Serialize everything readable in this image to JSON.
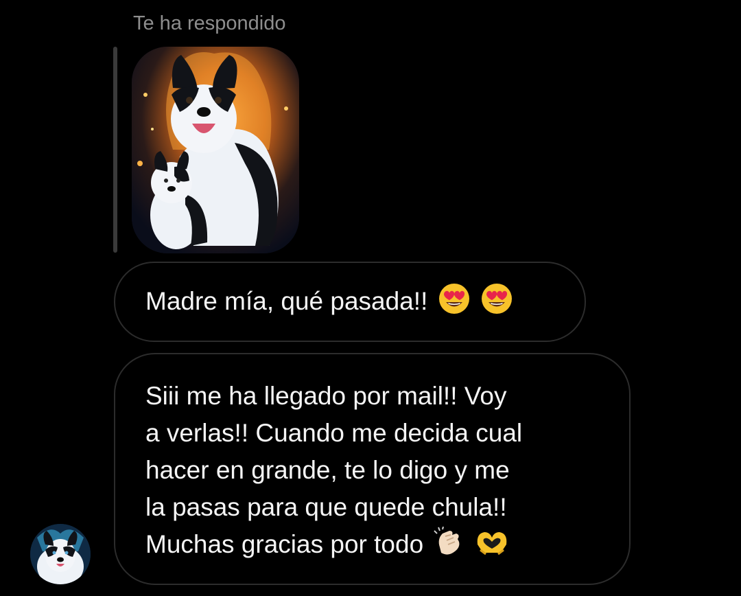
{
  "reply": {
    "header": "Te ha respondido",
    "image_icon": "border-collie-dogs-fire-illustration"
  },
  "messages": [
    {
      "text": "Madre mía, qué pasada!!",
      "emojis": [
        "heart-eyes-emoji",
        "heart-eyes-emoji"
      ]
    },
    {
      "lines": [
        "Siii me ha llegado por mail!! Voy",
        "a verlas!!  Cuando me decida cual",
        "hacer en grande, te lo digo y me",
        "la pasas para que quede chula!!",
        "Muchas gracias por todo"
      ],
      "emojis": [
        "clapping-hands-emoji",
        "heart-hands-emoji"
      ]
    }
  ],
  "avatar": {
    "icon": "border-collie-avatar"
  },
  "colors": {
    "background": "#000000",
    "bubble_border": "#2c2c2c",
    "header_text": "#8e8e8e",
    "message_text": "#f5f5f5"
  }
}
